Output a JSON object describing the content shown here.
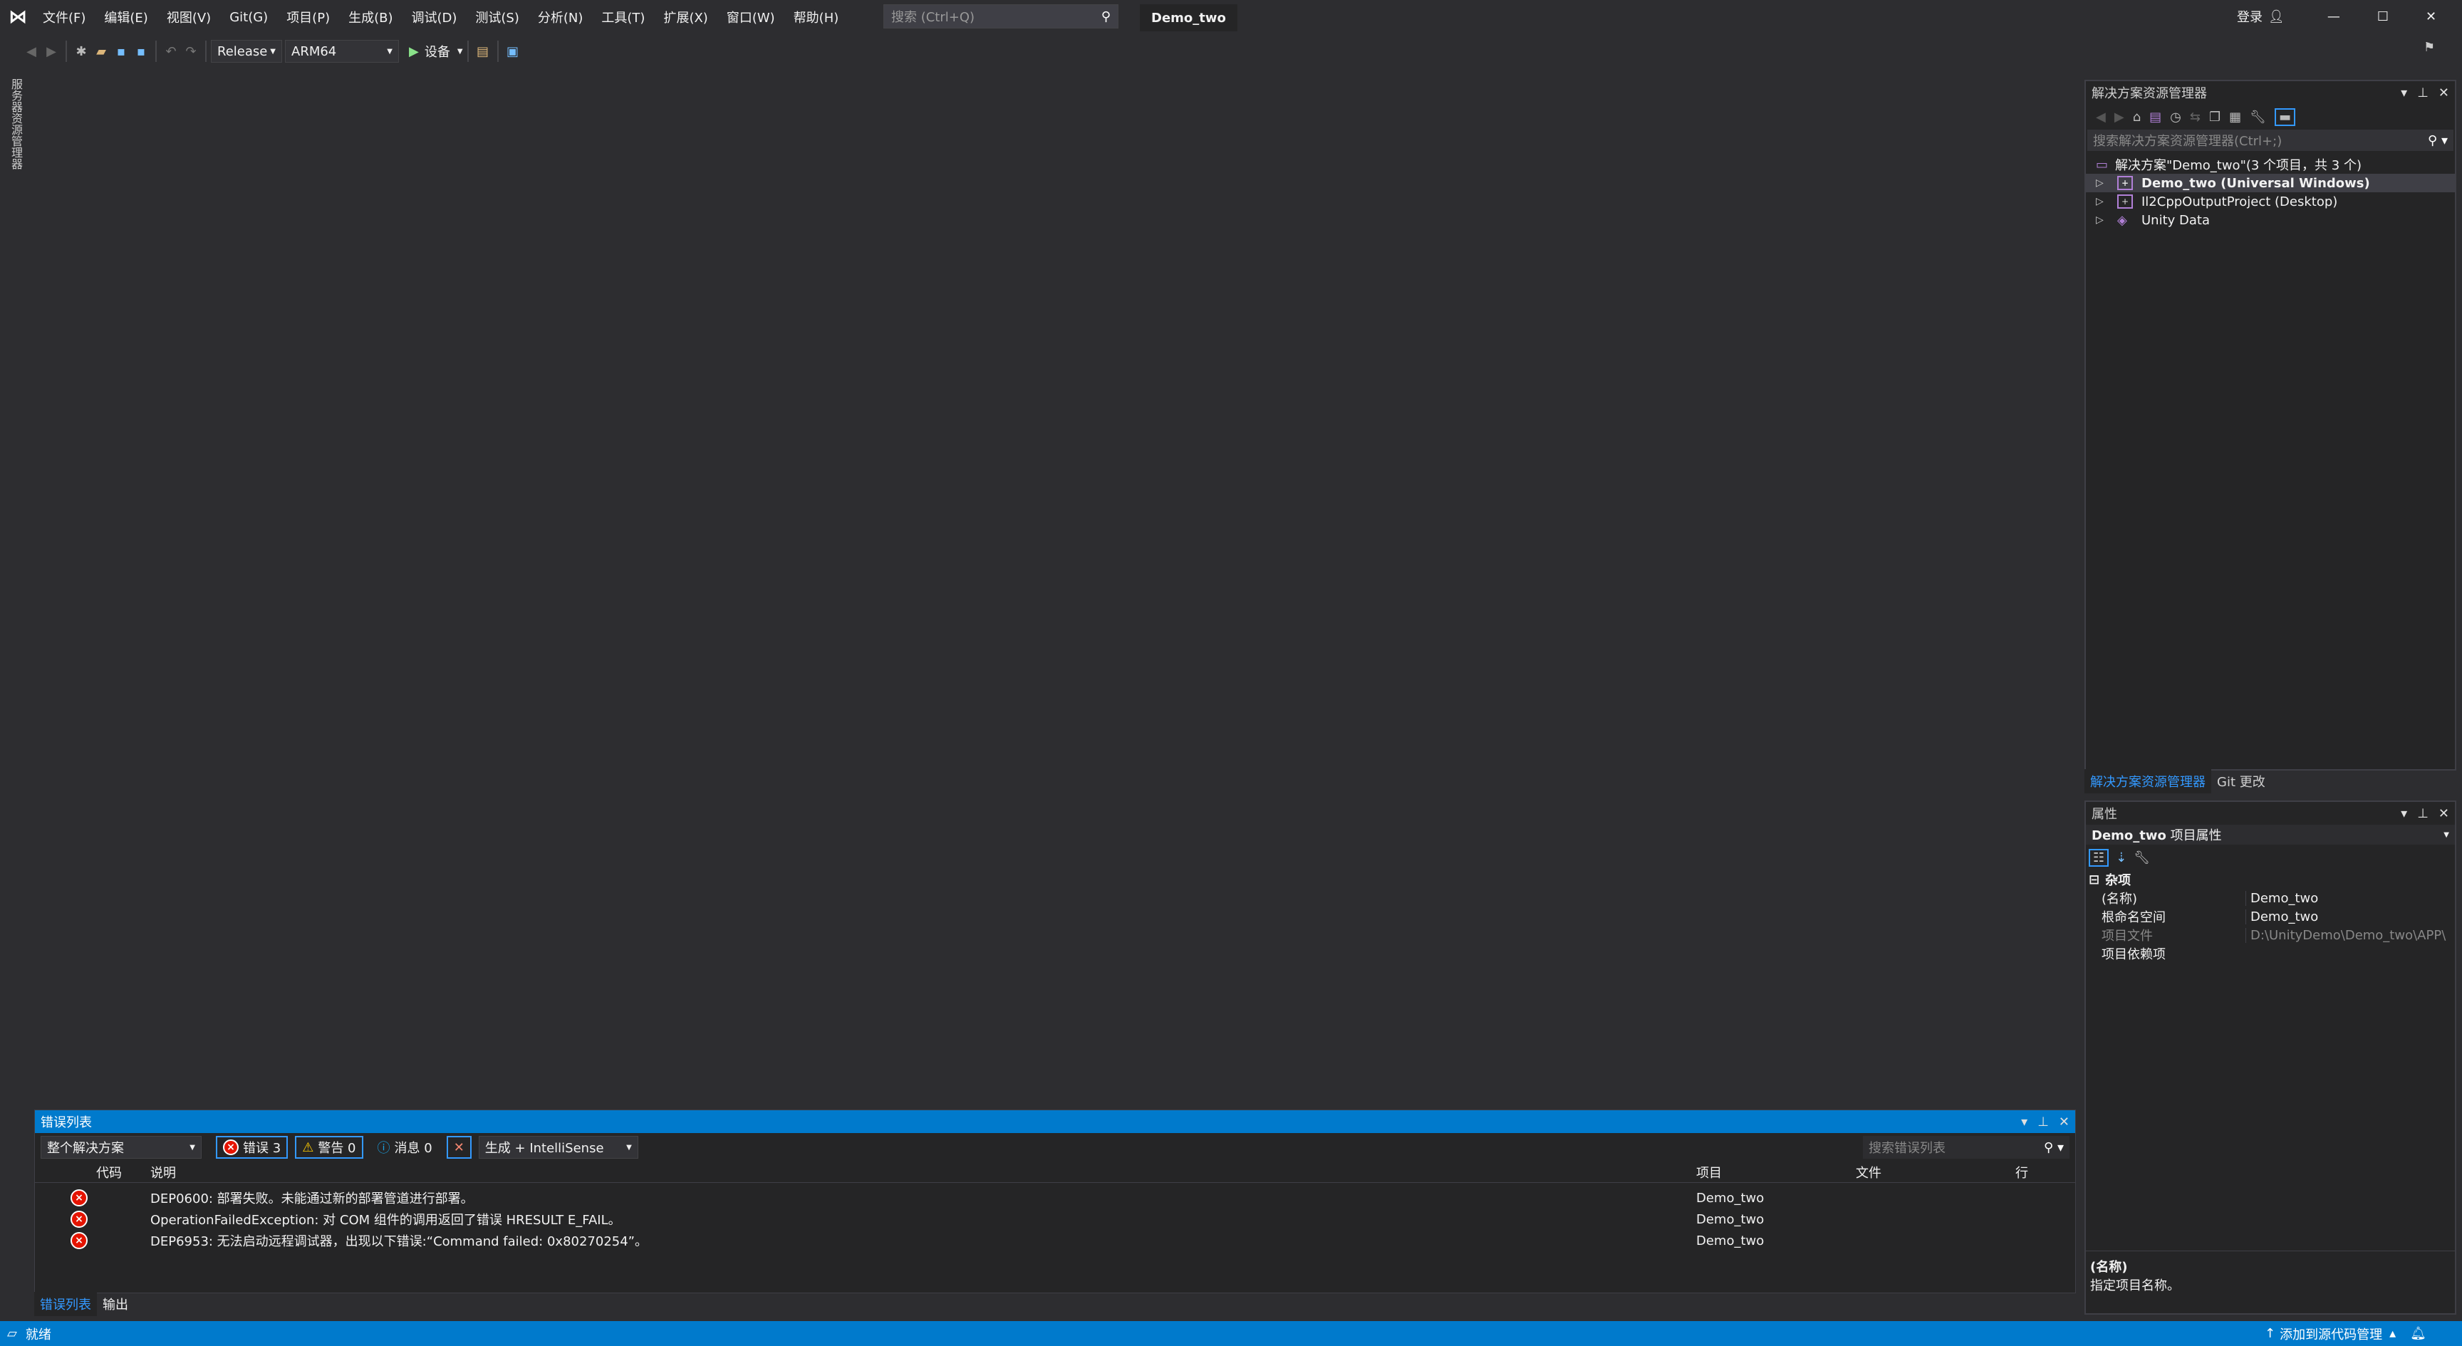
{
  "menubar": {
    "items": [
      "文件(F)",
      "编辑(E)",
      "视图(V)",
      "Git(G)",
      "项目(P)",
      "生成(B)",
      "调试(D)",
      "测试(S)",
      "分析(N)",
      "工具(T)",
      "扩展(X)",
      "窗口(W)",
      "帮助(H)"
    ],
    "search_placeholder": "搜索 (Ctrl+Q)",
    "title": "Demo_two",
    "login": "登录"
  },
  "toolbar": {
    "config": "Release",
    "platform": "ARM64",
    "run_label": "设备"
  },
  "left_strip": {
    "label": "服务器资源管理器"
  },
  "solution_explorer": {
    "title": "解决方案资源管理器",
    "search_placeholder": "搜索解决方案资源管理器(Ctrl+;)",
    "solution": "解决方案\"Demo_two\"(3 个项目，共 3 个)",
    "items": [
      {
        "label": "Demo_two (Universal Windows)",
        "bold": true
      },
      {
        "label": "Il2CppOutputProject (Desktop)"
      },
      {
        "label": "Unity Data"
      }
    ],
    "tabs": [
      "解决方案资源管理器",
      "Git 更改"
    ]
  },
  "properties": {
    "title": "属性",
    "object": "Demo_two",
    "object_type": "项目属性",
    "category": "杂项",
    "rows": [
      {
        "key": "(名称)",
        "value": "Demo_two"
      },
      {
        "key": "根命名空间",
        "value": "Demo_two"
      },
      {
        "key": "项目文件",
        "value": "D:\\UnityDemo\\Demo_two\\APP\\"
      },
      {
        "key": "项目依赖项",
        "value": ""
      }
    ],
    "desc_title": "(名称)",
    "desc_text": "指定项目名称。"
  },
  "error_list": {
    "title": "错误列表",
    "scope": "整个解决方案",
    "errors": "错误 3",
    "warnings": "警告 0",
    "messages": "消息 0",
    "source": "生成 + IntelliSense",
    "search_placeholder": "搜索错误列表",
    "columns": [
      "代码",
      "说明",
      "项目",
      "文件",
      "行"
    ],
    "rows": [
      {
        "desc": "DEP0600: 部署失败。未能通过新的部署管道进行部署。",
        "project": "Demo_two"
      },
      {
        "desc": "OperationFailedException: 对 COM 组件的调用返回了错误 HRESULT E_FAIL。",
        "project": "Demo_two"
      },
      {
        "desc": "DEP6953: 无法启动远程调试器，出现以下错误:“Command failed: 0x80270254”。",
        "project": "Demo_two"
      }
    ],
    "bottom_tabs": [
      "错误列表",
      "输出"
    ]
  },
  "status": {
    "left": "就绪",
    "right": "添加到源代码管理"
  },
  "colors": {
    "accent": "#007acc",
    "error": "#e51400",
    "warning": "#ffcc00",
    "info": "#1ba1e2"
  }
}
